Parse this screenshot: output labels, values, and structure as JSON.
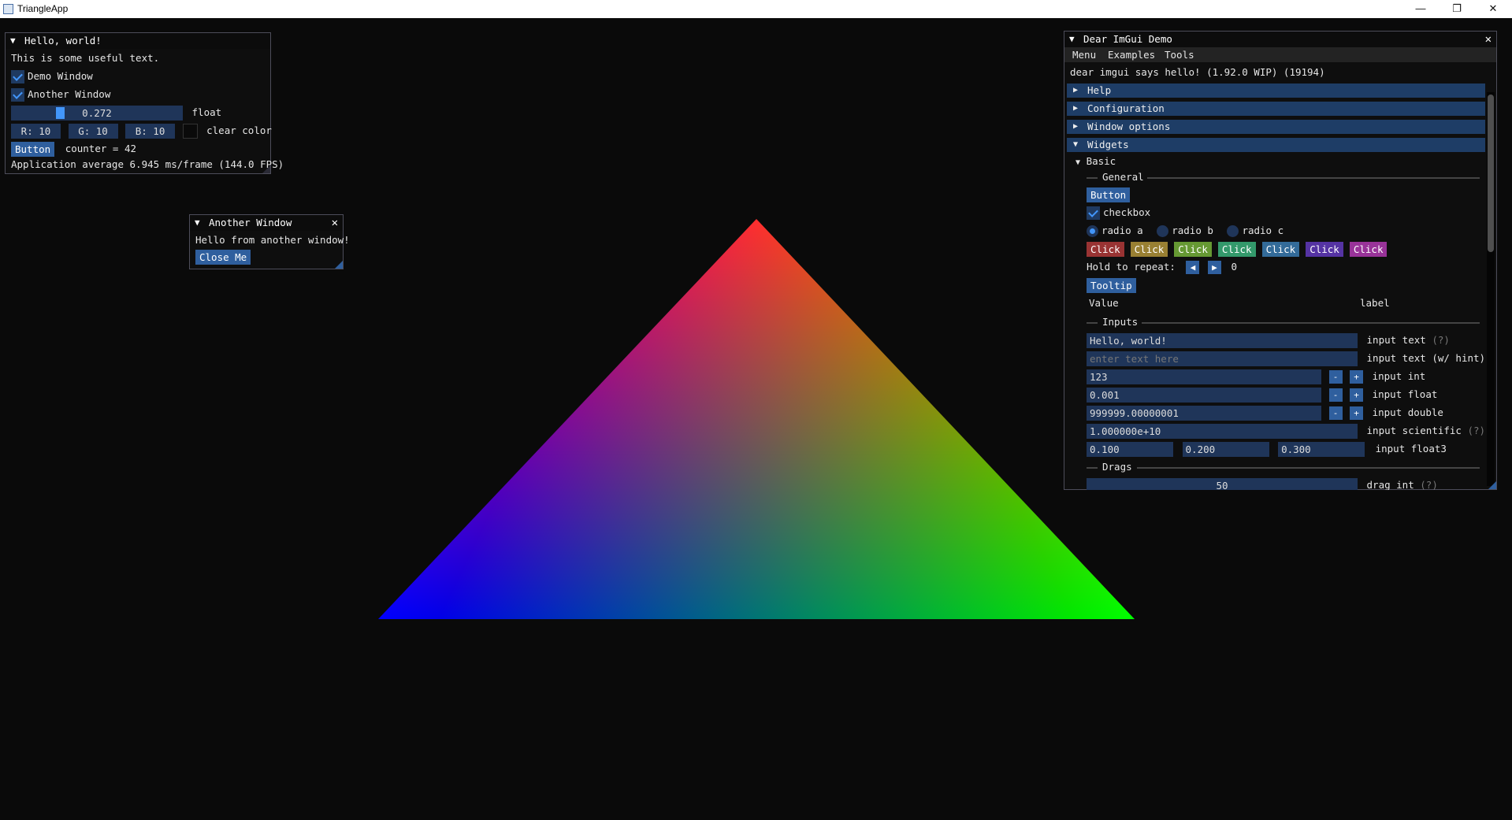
{
  "os_window": {
    "title": "TriangleApp",
    "minimize": "—",
    "maximize": "❐",
    "close": "✕"
  },
  "triangle": {
    "colors": {
      "top": "#ff0000",
      "left": "#0000ff",
      "right": "#00ff00"
    }
  },
  "hello_window": {
    "title": "Hello, world!",
    "text": "This is some useful text.",
    "demo_window_label": "Demo Window",
    "demo_window_checked": true,
    "another_window_label": "Another Window",
    "another_window_checked": true,
    "float_value": "0.272",
    "float_label": "float",
    "r": "R: 10",
    "g": "G: 10",
    "b": "B: 10",
    "clear_color_label": "clear color",
    "button_label": "Button",
    "counter": "counter = 42",
    "average": "Application average 6.945 ms/frame (144.0 FPS)"
  },
  "another_window": {
    "title": "Another Window",
    "text": "Hello from another window!",
    "close_button": "Close Me"
  },
  "demo_window": {
    "title": "Dear ImGui Demo",
    "menu": [
      "Menu",
      "Examples",
      "Tools"
    ],
    "hello": "dear imgui says hello! (1.92.0 WIP) (19194)",
    "headers": [
      "Help",
      "Configuration",
      "Window options",
      "Widgets"
    ],
    "basic_label": "Basic",
    "general_label": "General",
    "button_label": "Button",
    "checkbox_label": "checkbox",
    "radios": [
      "radio a",
      "radio b",
      "radio c"
    ],
    "click_buttons": [
      {
        "label": "Click",
        "color": "#993333"
      },
      {
        "label": "Click",
        "color": "#998033"
      },
      {
        "label": "Click",
        "color": "#669933"
      },
      {
        "label": "Click",
        "color": "#33996b"
      },
      {
        "label": "Click",
        "color": "#336b99"
      },
      {
        "label": "Click",
        "color": "#5533a3"
      },
      {
        "label": "Click",
        "color": "#993399"
      }
    ],
    "hold_repeat": "Hold to repeat:",
    "repeat_value": "0",
    "tooltip_label": "Tooltip",
    "value_header": "Value",
    "label_header": "label",
    "inputs_label": "Inputs",
    "input_text_value": "Hello, world!",
    "input_text_label": "input text",
    "help_marker": "(?)",
    "input_hint_placeholder": "enter text here",
    "input_hint_label": "input text (w/ hint)",
    "input_int_value": "123",
    "input_int_label": "input int",
    "input_float_value": "0.001",
    "input_float_label": "input float",
    "input_double_value": "999999.00000001",
    "input_double_label": "input double",
    "input_sci_value": "1.000000e+10",
    "input_sci_label": "input scientific",
    "float3": [
      "0.100",
      "0.200",
      "0.300"
    ],
    "float3_label": "input float3",
    "drags_label": "Drags",
    "drag_int_value": "50",
    "drag_int_label": "drag int",
    "minus": "-",
    "plus": "+"
  }
}
